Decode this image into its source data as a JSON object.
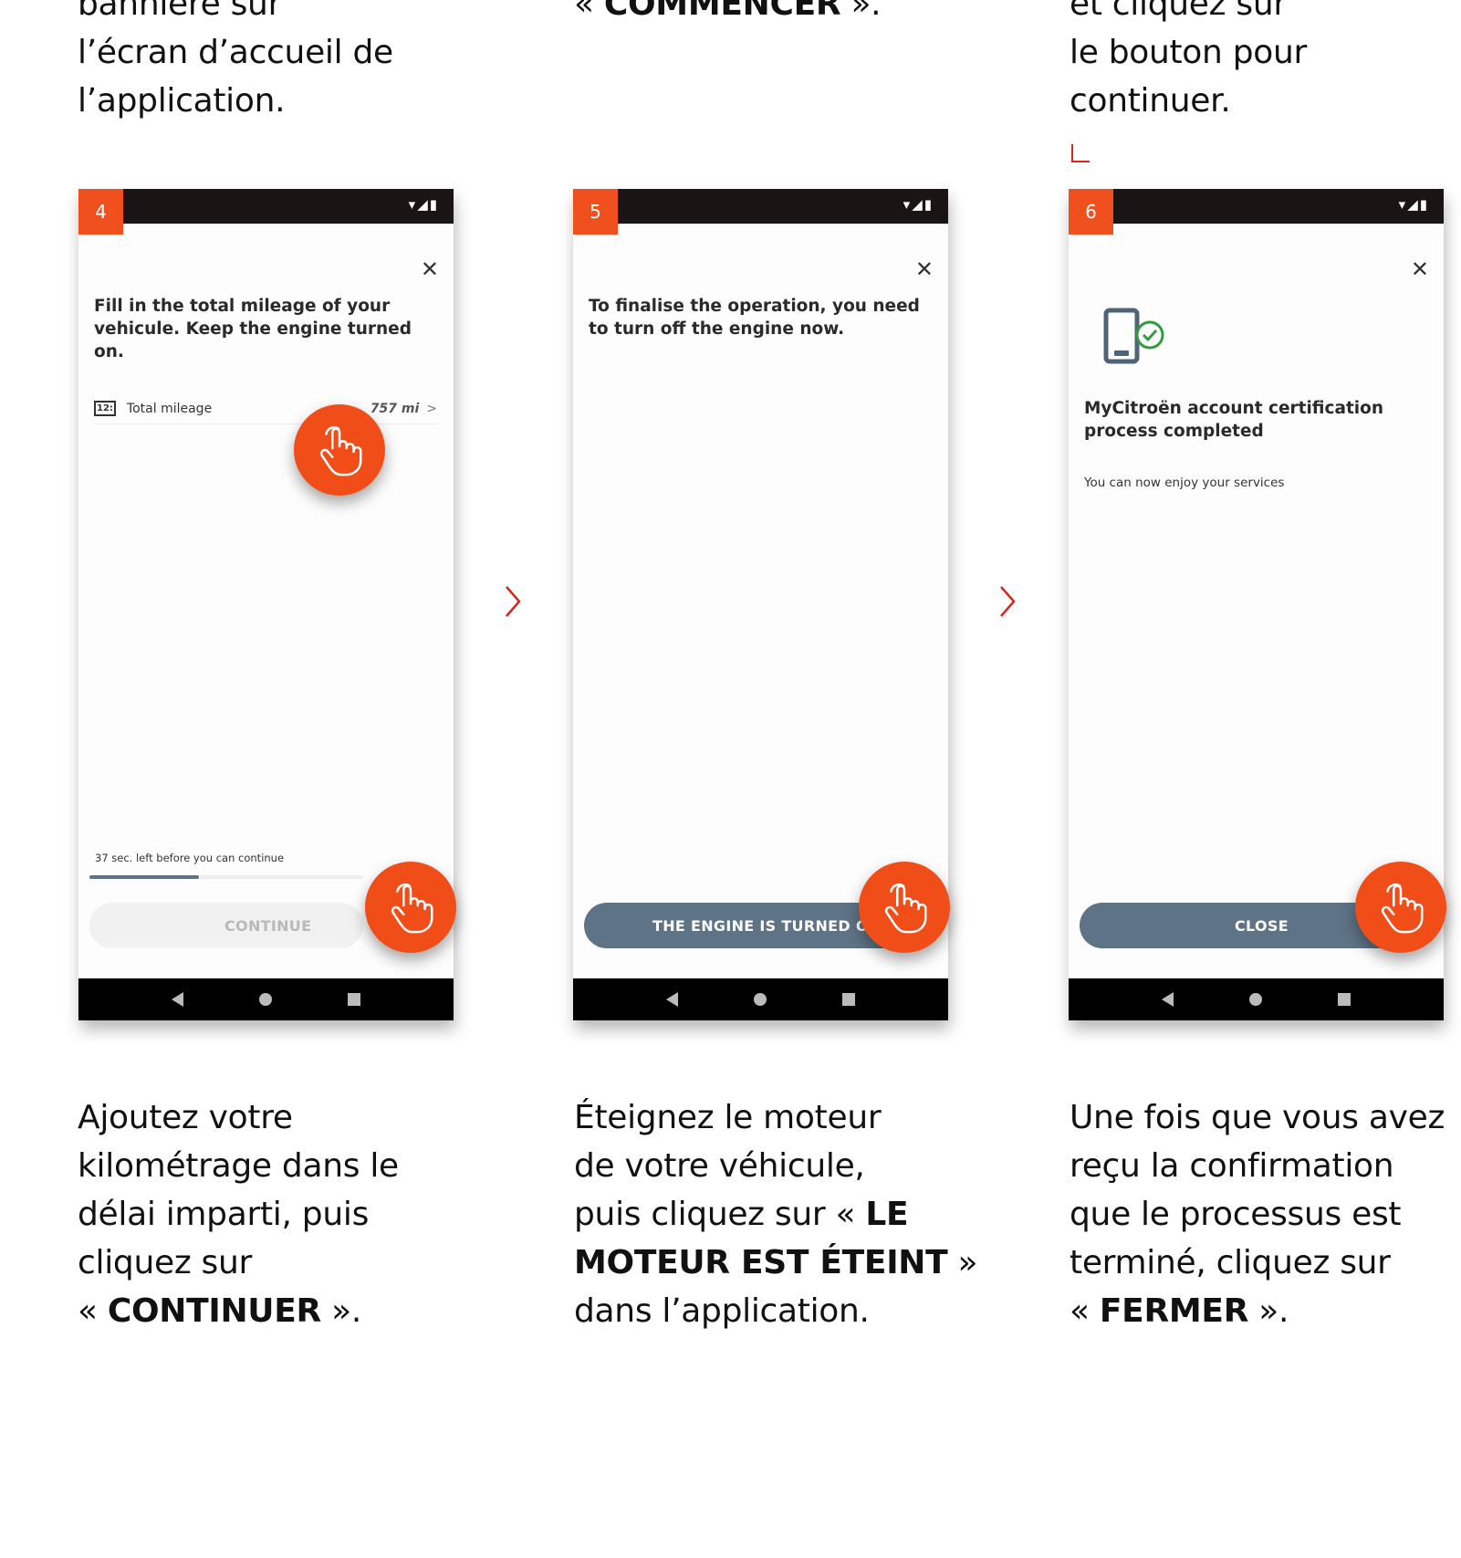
{
  "columns": [
    {
      "top_caption": [
        "bannière sur",
        "l’écran d’accueil de",
        "l’application."
      ],
      "step": "4",
      "close_glyph": "✕",
      "heading": "Fill in the total mileage of your vehicule. Keep the engine turned on.",
      "mileage_row": {
        "icon_text": "12:",
        "label": "Total mileage",
        "value": "757 mi",
        "chevron": ">"
      },
      "timer_text": "37 sec. left before you can continue",
      "timer_progress": 0.4,
      "button_label": "CONTINUE",
      "bottom_caption": {
        "lines": [
          "Ajoutez votre",
          "kilométrage dans le",
          "délai imparti, puis",
          "cliquez sur"
        ],
        "final_prefix": "« ",
        "final_bold": "CONTINUER",
        "final_suffix": " »."
      }
    },
    {
      "top_caption_prefix": "« ",
      "top_caption_bold": "COMMENCER",
      "top_caption_suffix": " ».",
      "step": "5",
      "close_glyph": "✕",
      "heading": "To finalise the operation, you need to turn off the engine now.",
      "button_label": "THE ENGINE IS TURNED OFF",
      "bottom_caption": {
        "line1": "Éteignez le moteur",
        "line2": "de votre véhicule,",
        "line3_prefix": "puis cliquez sur « ",
        "line3_bold": "LE",
        "line4_bold": "MOTEUR EST ÉTEINT",
        "line4_suffix": " »",
        "line5": "dans l’application."
      }
    },
    {
      "top_caption": [
        "et cliquez sur",
        "le bouton pour",
        "continuer."
      ],
      "step": "6",
      "close_glyph": "✕",
      "heading": "MyCitroën account certification process completed",
      "subtext": "You can now enjoy your services",
      "button_label": "CLOSE",
      "bottom_caption": {
        "lines": [
          "Une fois que vous avez",
          "reçu la confirmation",
          "que le processus est",
          "terminé, cliquez sur"
        ],
        "final_prefix": "« ",
        "final_bold": "FERMER",
        "final_suffix": " »."
      }
    }
  ],
  "status_icons": "▾◢▮",
  "colors": {
    "accent": "#f0501e",
    "button": "#5e7486",
    "status_bar": "#1b1414",
    "arrow": "#d9261c"
  }
}
